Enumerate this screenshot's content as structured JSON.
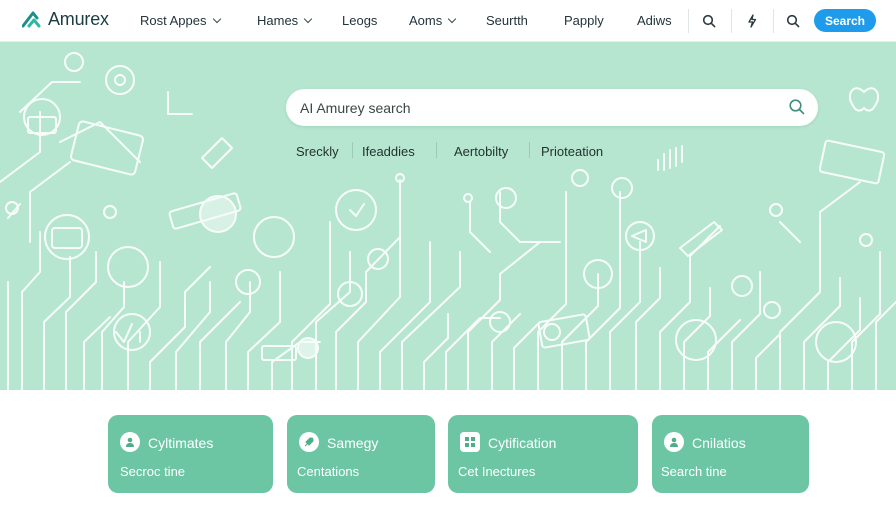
{
  "brand": {
    "name": "Amurex"
  },
  "nav": {
    "items": [
      {
        "label": "Rost Appes",
        "has_dropdown": true
      },
      {
        "label": "Hames",
        "has_dropdown": true
      },
      {
        "label": "Leogs",
        "has_dropdown": false
      },
      {
        "label": "Aoms",
        "has_dropdown": true
      },
      {
        "label": "Seurtth",
        "has_dropdown": false
      },
      {
        "label": "Papply",
        "has_dropdown": false
      },
      {
        "label": "Adiws",
        "has_dropdown": false
      }
    ],
    "icons": [
      "search-icon",
      "lightning-icon",
      "search-icon"
    ],
    "search_button": "Search"
  },
  "hero": {
    "search_placeholder": "AI Amurey search",
    "quick_links": [
      "Sreckly",
      "Ifeaddies",
      "Aertobilty",
      "Prioteation"
    ],
    "background_color": "#b6e6cf"
  },
  "cards": [
    {
      "title": "Cyltimates",
      "subtitle": "Secroc tine",
      "icon": "user-icon"
    },
    {
      "title": "Samegy",
      "subtitle": "Centations",
      "icon": "rocket-icon"
    },
    {
      "title": "Cytification",
      "subtitle": "Cet Inectures",
      "icon": "grid-icon"
    },
    {
      "title": "Cnilatios",
      "subtitle": "Search tine",
      "icon": "user-icon"
    }
  ],
  "colors": {
    "accent": "#1f9bec",
    "card": "#6dc6a3",
    "hero": "#b6e6cf"
  }
}
